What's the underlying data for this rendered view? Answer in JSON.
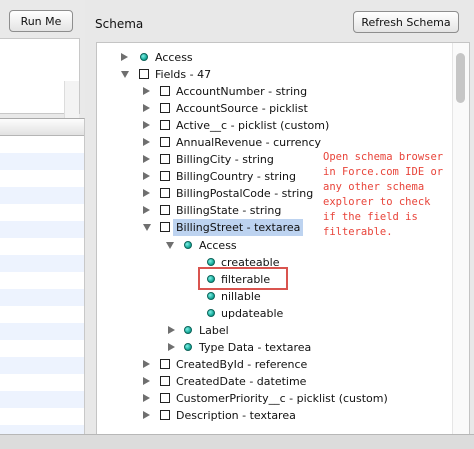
{
  "toolbar": {
    "run_label": "Run Me"
  },
  "schema": {
    "title": "Schema",
    "refresh_label": "Refresh Schema",
    "tree": {
      "access": "Access",
      "fields": "Fields - 47",
      "field_items": [
        "AccountNumber - string",
        "AccountSource - picklist",
        "Active__c - picklist (custom)",
        "AnnualRevenue - currency",
        "BillingCity - string",
        "BillingCountry - string",
        "BillingPostalCode - string",
        "BillingState - string",
        "BillingStreet - textarea"
      ],
      "billing_access": "Access",
      "access_props": [
        "createable",
        "filterable",
        "nillable",
        "updateable"
      ],
      "label_node": "Label",
      "type_data_node": "Type Data - textarea",
      "more_fields": [
        "CreatedById - reference",
        "CreatedDate - datetime",
        "CustomerPriority__c - picklist (custom)",
        "Description - textarea"
      ]
    },
    "annotation": "Open schema browser\nin Force.com IDE or\nany other schema\nexplorer to check\nif the field is\nfilterable."
  },
  "colors": {
    "annotation": "#e8443a",
    "selection": "#bdd3f0",
    "node_dot": "#13a898"
  }
}
